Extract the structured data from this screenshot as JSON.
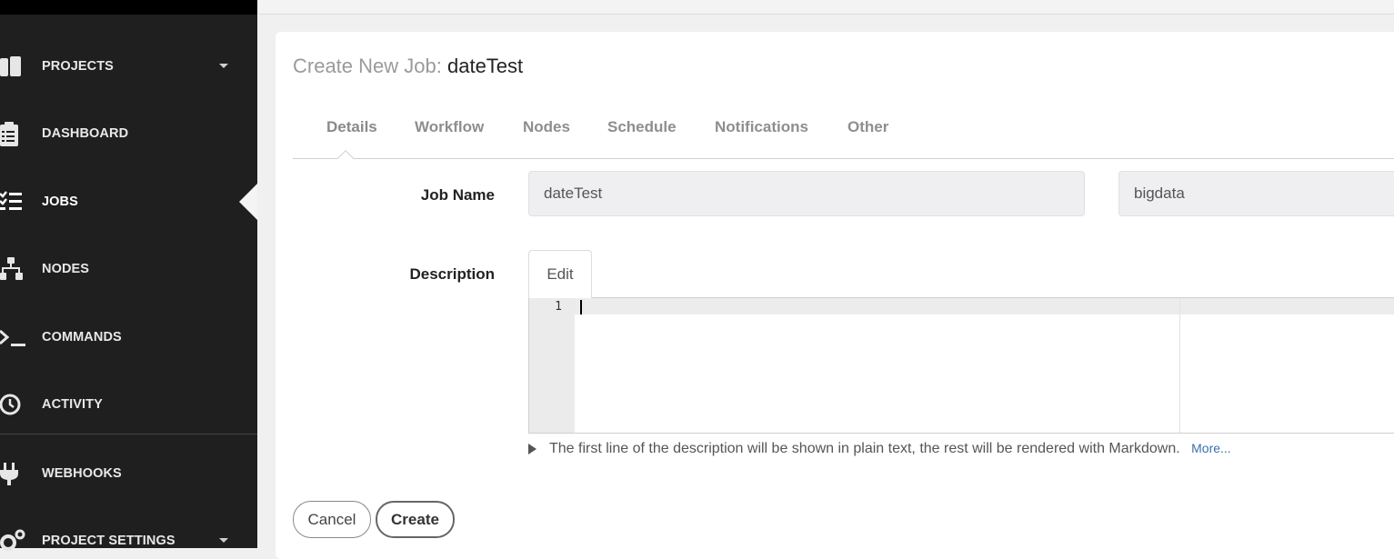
{
  "sidebar": {
    "items": [
      {
        "name": "projects",
        "label": "PROJECTS",
        "icon": "projects-icon",
        "has_caret": true
      },
      {
        "name": "dashboard",
        "label": "DASHBOARD",
        "icon": "clipboard-icon"
      },
      {
        "name": "jobs",
        "label": "JOBS",
        "icon": "list-check-icon",
        "active": true
      },
      {
        "name": "nodes",
        "label": "NODES",
        "icon": "sitemap-icon"
      },
      {
        "name": "commands",
        "label": "COMMANDS",
        "icon": "terminal-icon"
      },
      {
        "name": "activity",
        "label": "ACTIVITY",
        "icon": "history-icon"
      },
      {
        "name": "webhooks",
        "label": "WEBHOOKS",
        "icon": "plug-icon"
      },
      {
        "name": "project-settings",
        "label": "PROJECT SETTINGS",
        "icon": "cogs-icon",
        "has_caret": true
      }
    ]
  },
  "page": {
    "title_prefix": "Create New Job:",
    "job_name": "dateTest"
  },
  "tabs": [
    "Details",
    "Workflow",
    "Nodes",
    "Schedule",
    "Notifications",
    "Other"
  ],
  "active_tab": "Details",
  "form": {
    "job_name_label": "Job Name",
    "job_name_value": "dateTest",
    "group_value": "bigdata",
    "description_label": "Description",
    "edit_tab_label": "Edit",
    "editor_line_number": "1",
    "hint_text": "The first line of the description will be shown in plain text, the rest will be rendered with Markdown.",
    "hint_more": "More..."
  },
  "buttons": {
    "cancel": "Cancel",
    "create": "Create"
  },
  "colors": {
    "sidebar_bg": "#1f1f1f",
    "link": "#3b6fb0"
  }
}
